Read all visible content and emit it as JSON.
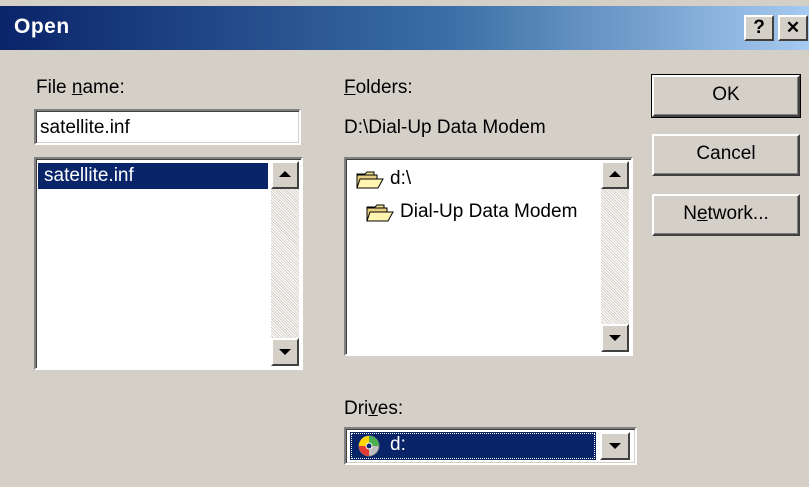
{
  "window": {
    "title": "Open",
    "help_glyph": "?",
    "close_glyph": "✕"
  },
  "file_name": {
    "label_pre": "File ",
    "label_mn": "n",
    "label_post": "ame:",
    "value": "satellite.inf",
    "list": [
      "satellite.inf"
    ]
  },
  "folders": {
    "label_mn": "F",
    "label_post": "olders:",
    "current_path": "D:\\Dial-Up Data Modem",
    "items": [
      "d:\\",
      "Dial-Up Data Modem"
    ]
  },
  "drives": {
    "label_pre": "Dri",
    "label_mn": "v",
    "label_post": "es:",
    "selected": "d:"
  },
  "buttons": {
    "ok": "OK",
    "cancel": "Cancel",
    "network_pre": "N",
    "network_mn": "e",
    "network_post": "twork..."
  },
  "colors": {
    "selection": "#0a246a",
    "face": "#d4d0c8"
  }
}
